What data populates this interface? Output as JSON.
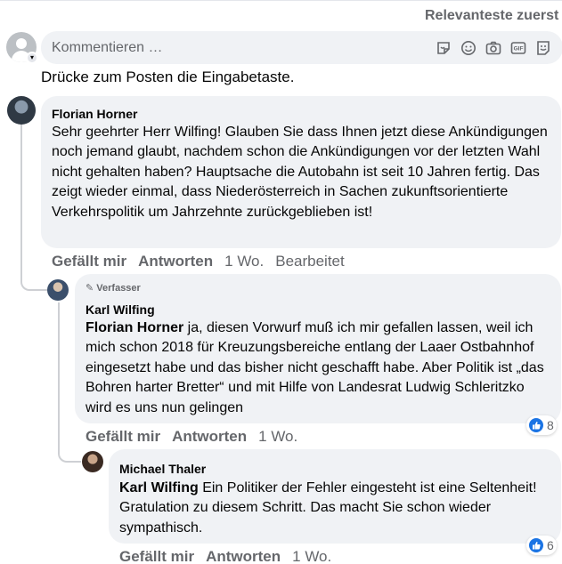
{
  "header": {
    "sort_label": "Relevanteste zuerst"
  },
  "composer": {
    "placeholder": "Kommentieren …",
    "icons": [
      "sticker-icon",
      "emoji-icon",
      "camera-icon",
      "gif-icon",
      "avatar-sticker-icon"
    ],
    "hint": "Drücke zum Posten die Eingabetaste."
  },
  "comments": [
    {
      "author": "Florian Horner",
      "text": "Sehr geehrter Herr Wilfing! Glauben Sie dass Ihnen jetzt diese Ankündigungen noch jemand glaubt, nachdem schon die Ankündigungen vor der letzten Wahl nicht gehalten haben? Hauptsache die Autobahn ist seit 10 Jahren fertig. Das zeigt wieder einmal, dass Niederösterreich in Sachen zukunftsorientierte Verkehrspolitik um Jahrzehnte zurückgeblieben ist!",
      "like_label": "Gefällt mir",
      "reply_label": "Antworten",
      "time": "1 Wo.",
      "edited": "Bearbeitet"
    },
    {
      "badge": "Verfasser",
      "author": "Karl Wilfing",
      "mention": "Florian Horner",
      "text": " ja, diesen Vorwurf muß ich mir gefallen lassen, weil ich mich schon 2018 für Kreuzungsbereiche entlang der Laaer Ostbahnhof eingesetzt habe und das bisher nicht geschafft habe. Aber Politik ist „das Bohren harter Bretter“ und mit Hilfe von Landesrat Ludwig Schleritzko wird es uns nun gelingen",
      "like_label": "Gefällt mir",
      "reply_label": "Antworten",
      "time": "1 Wo.",
      "reaction_count": "8"
    },
    {
      "author": "Michael Thaler",
      "mention": "Karl Wilfing",
      "text": " Ein Politiker der Fehler eingesteht ist eine Seltenheit! Gratulation zu diesem Schritt. Das macht Sie schon wieder sympathisch.",
      "like_label": "Gefällt mir",
      "reply_label": "Antworten",
      "time": "1 Wo.",
      "reaction_count": "6"
    }
  ],
  "colors": {
    "bubble": "#f0f2f5",
    "secondary_text": "#65676b",
    "primary_text": "#050505",
    "like_blue": "#1b74e4",
    "thread_line": "#ced0d4"
  }
}
